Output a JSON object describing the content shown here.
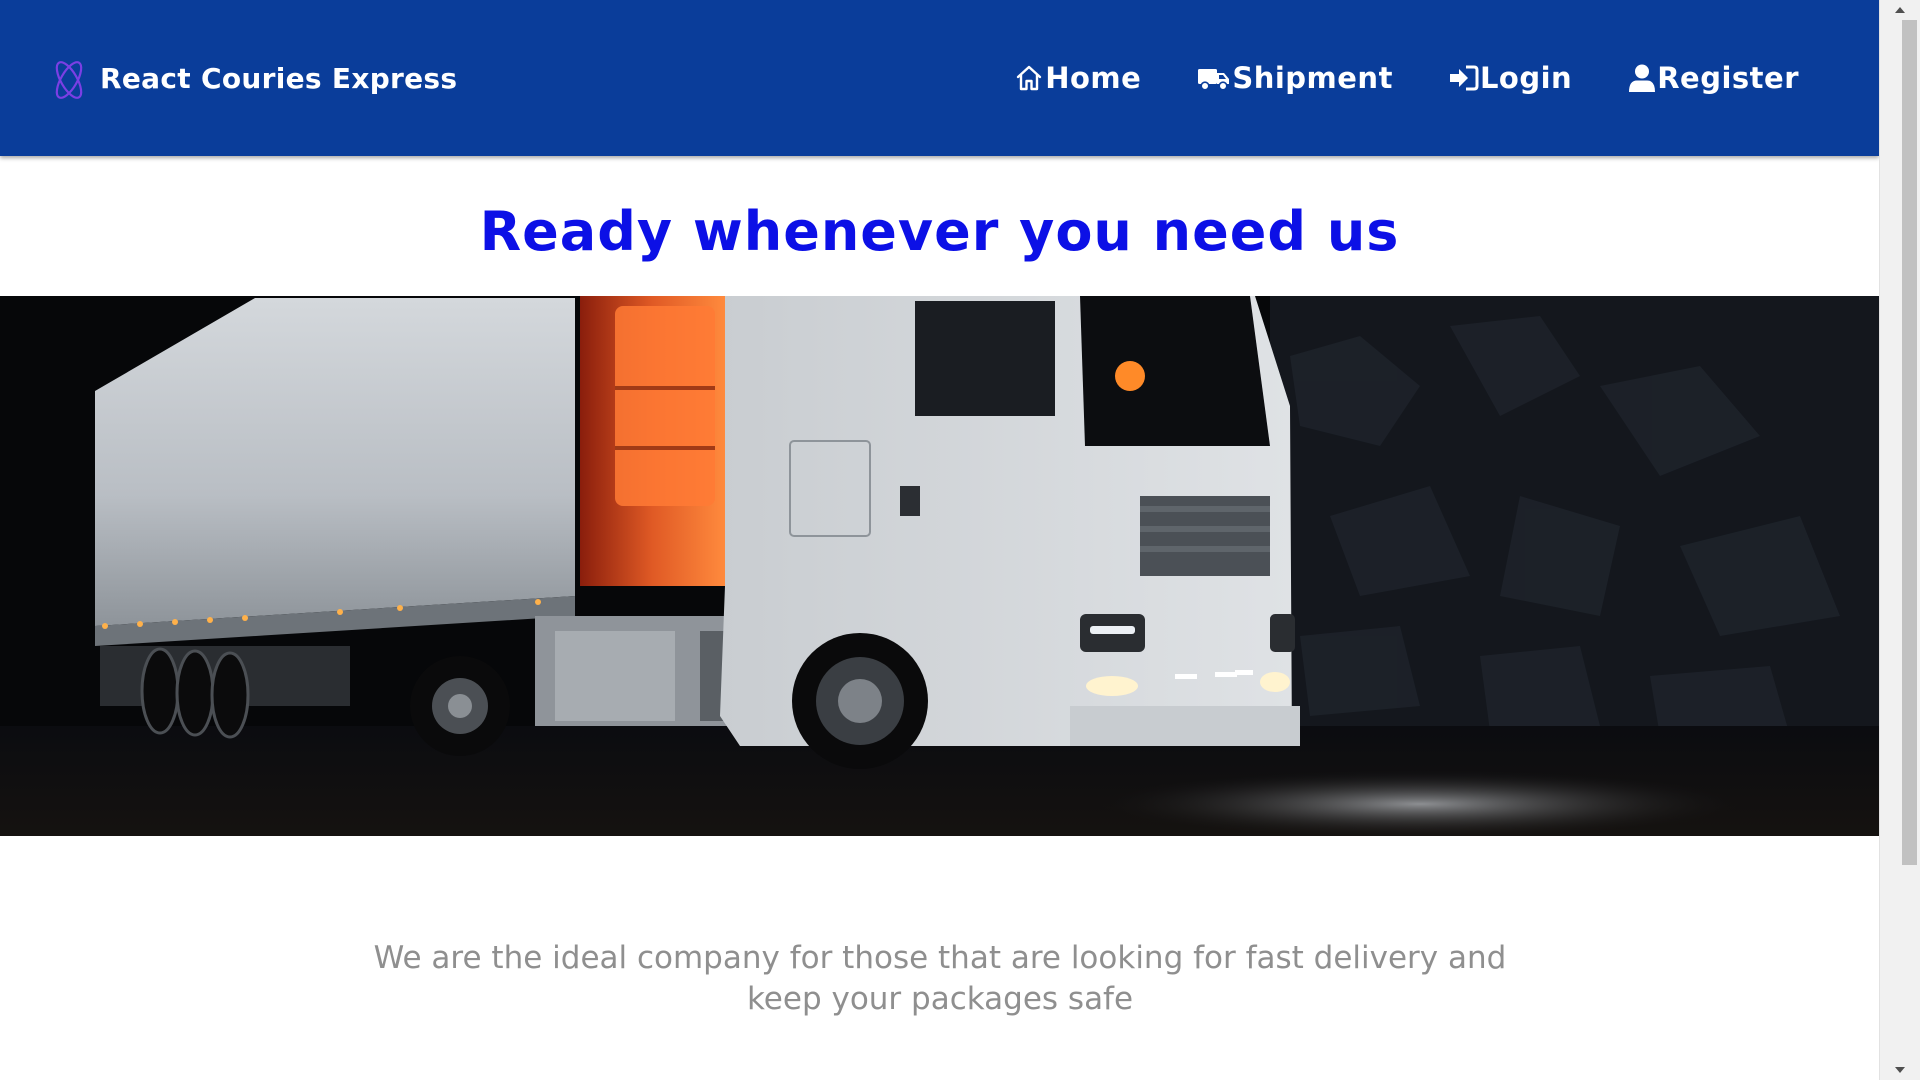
{
  "navbar": {
    "brand_name": "React Couries Express",
    "brand_icon": "react-logo-icon",
    "background": "#0a3d9a",
    "links": [
      {
        "label": "Home",
        "icon": "home-icon"
      },
      {
        "label": "Shipment",
        "icon": "truck-icon"
      },
      {
        "label": "Login",
        "icon": "sign-in-icon"
      },
      {
        "label": "Register",
        "icon": "user-icon"
      }
    ]
  },
  "hero": {
    "headline": "Ready whenever you need us",
    "headline_color": "#0c10e6",
    "image_description_icon": "truck-night-photo"
  },
  "tagline": {
    "text": "We are the ideal company for those that are looking for fast delivery and keep your packages safe"
  }
}
